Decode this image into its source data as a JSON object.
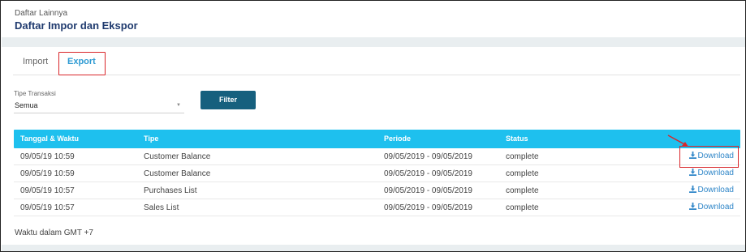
{
  "header": {
    "breadcrumb": "Daftar Lainnya",
    "title": "Daftar Impor dan Ekspor"
  },
  "tabs": [
    {
      "label": "Import",
      "active": false
    },
    {
      "label": "Export",
      "active": true
    }
  ],
  "filter": {
    "label": "Tipe Transaksi",
    "selected": "Semua",
    "button_label": "Filter"
  },
  "table": {
    "columns": [
      "Tanggal & Waktu",
      "Tipe",
      "Periode",
      "Status"
    ],
    "rows": [
      {
        "date": "09/05/19 10:59",
        "type": "Customer Balance",
        "period": "09/05/2019 - 09/05/2019",
        "status": "complete",
        "action": "Download"
      },
      {
        "date": "09/05/19 10:59",
        "type": "Customer Balance",
        "period": "09/05/2019 - 09/05/2019",
        "status": "complete",
        "action": "Download"
      },
      {
        "date": "09/05/19 10:57",
        "type": "Purchases List",
        "period": "09/05/2019 - 09/05/2019",
        "status": "complete",
        "action": "Download"
      },
      {
        "date": "09/05/19 10:57",
        "type": "Sales List",
        "period": "09/05/2019 - 09/05/2019",
        "status": "complete",
        "action": "Download"
      }
    ]
  },
  "footnote": "Waktu dalam GMT +7",
  "icons": {
    "download": "download-icon",
    "dropdown": "caret-down-icon"
  },
  "colors": {
    "header_row": "#1ec0ee",
    "filter_button": "#16607e",
    "link": "#2f86c8",
    "active_tab": "#2f9bd3",
    "highlight": "#d9262a",
    "title": "#1f3a6e"
  }
}
